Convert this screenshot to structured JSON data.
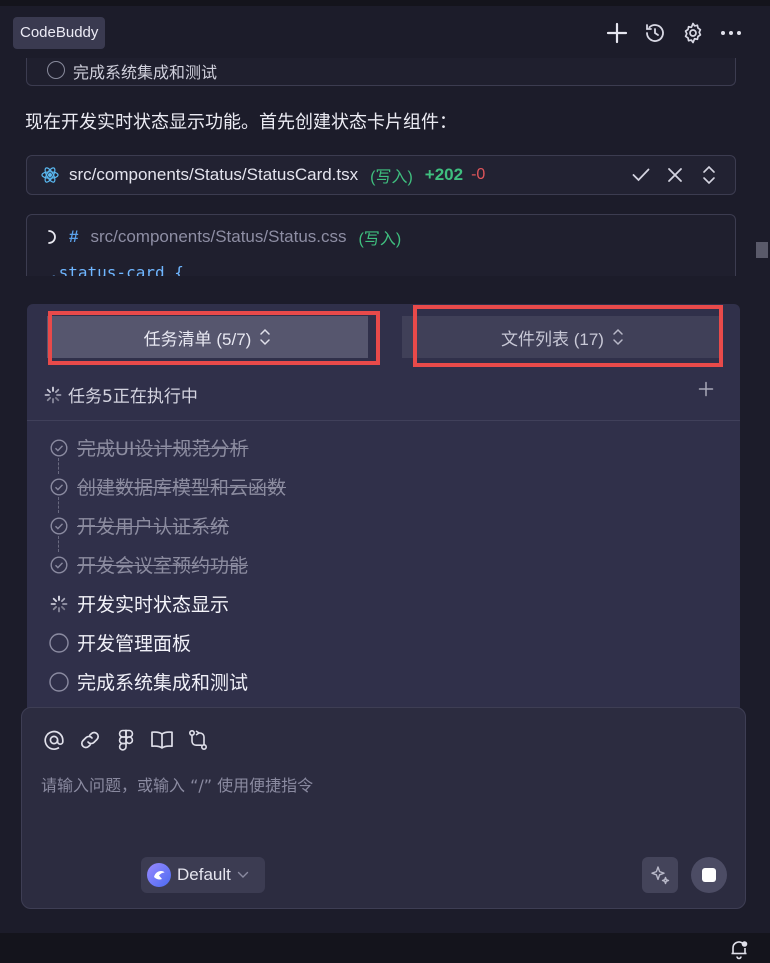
{
  "header": {
    "app_title": "CodeBuddy",
    "icons": [
      "plus-icon",
      "history-icon",
      "gear-icon",
      "more-icon"
    ]
  },
  "chat": {
    "prev_task_text": "完成系统集成和测试",
    "message": "现在开发实时状态显示功能。首先创建状态卡片组件：",
    "file1": {
      "path": "src/components/Status/StatusCard.tsx",
      "write_label": "(写入)",
      "added": "+202",
      "removed": "-0"
    },
    "file2": {
      "path": "src/components/Status/Status.css",
      "write_label": "(写入)",
      "code_line": ".status-card {"
    }
  },
  "panel": {
    "tab_tasks": "任务清单 (5/7)",
    "tab_files": "文件列表 (17)",
    "status_text": "任务5正在执行中",
    "tasks": [
      {
        "label": "完成UI设计规范分析",
        "state": "done"
      },
      {
        "label": "创建数据库模型和云函数",
        "state": "done"
      },
      {
        "label": "开发用户认证系统",
        "state": "done"
      },
      {
        "label": "开发会议室预约功能",
        "state": "done"
      },
      {
        "label": "开发实时状态显示",
        "state": "active"
      },
      {
        "label": "开发管理面板",
        "state": "todo"
      },
      {
        "label": "完成系统集成和测试",
        "state": "todo"
      }
    ]
  },
  "input": {
    "placeholder": "请输入问题，或输入 “/” 使用便捷指令",
    "tools": [
      "at-icon",
      "link-icon",
      "figma-icon",
      "book-icon",
      "git-icon"
    ],
    "model": "Default"
  },
  "colors": {
    "accent": "#6a5ae8",
    "added": "#3fbf7f",
    "removed": "#e0555a",
    "highlight": "#e84a4a"
  }
}
